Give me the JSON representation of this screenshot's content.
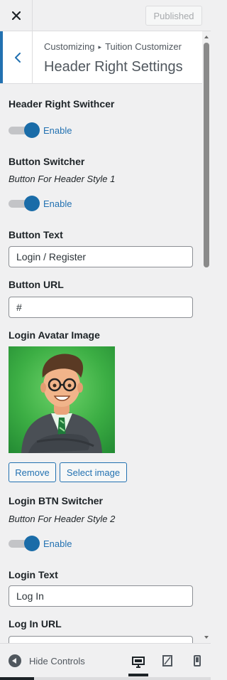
{
  "topbar": {
    "close_icon": "close-icon",
    "publish_label": "Published"
  },
  "section": {
    "back_icon": "chevron-left-icon",
    "breadcrumb_root": "Customizing",
    "breadcrumb_arrow": "▸",
    "breadcrumb_parent": "Tuition Customizer",
    "title": "Header Right Settings"
  },
  "controls": {
    "header_right_switcher": {
      "title": "Header Right Swithcer",
      "toggle_label": "Enable",
      "enabled": true
    },
    "button_switcher": {
      "title": "Button Switcher",
      "description": "Button For Header Style 1",
      "toggle_label": "Enable",
      "enabled": true
    },
    "button_text": {
      "title": "Button Text",
      "value": "Login / Register"
    },
    "button_url": {
      "title": "Button URL",
      "value": "#"
    },
    "login_avatar": {
      "title": "Login Avatar Image",
      "remove_label": "Remove",
      "select_label": "Select image"
    },
    "login_btn_switcher": {
      "title": "Login BTN Switcher",
      "description": "Button For Header Style 2",
      "toggle_label": "Enable",
      "enabled": true
    },
    "login_text": {
      "title": "Login Text",
      "value": "Log In"
    },
    "login_url": {
      "title": "Log In URL",
      "value": "#"
    }
  },
  "footer": {
    "hide_controls_label": "Hide Controls",
    "hide_icon": "arrow-left-circle-icon",
    "devices": [
      "desktop-icon",
      "tablet-icon",
      "mobile-icon"
    ],
    "active_device": "desktop"
  },
  "colors": {
    "accent": "#2271b1",
    "toggle_on": "#1a6ca8",
    "avatar_bg": "#3cae44"
  }
}
